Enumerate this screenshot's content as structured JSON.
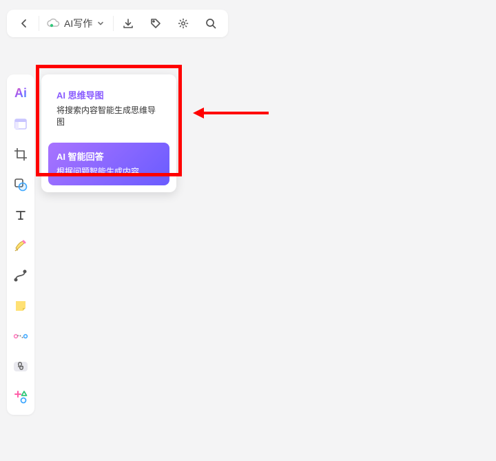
{
  "topbar": {
    "ai_write_label": "AI写作",
    "icons": {
      "back": "back-icon",
      "cloud": "cloud-sync-icon",
      "chevron": "chevron-down-icon",
      "download": "download-icon",
      "tag": "tag-icon",
      "settings": "gear-icon",
      "search": "search-icon"
    }
  },
  "sidebar": {
    "ai_label": "Ai",
    "tools": [
      {
        "name": "ai-tool",
        "icon": "ai-icon"
      },
      {
        "name": "frame-tool",
        "icon": "frame-icon"
      },
      {
        "name": "crop-tool",
        "icon": "crop-icon"
      },
      {
        "name": "shape-tool",
        "icon": "shape-combine-icon"
      },
      {
        "name": "text-tool",
        "icon": "text-icon"
      },
      {
        "name": "pen-tool",
        "icon": "pen-icon"
      },
      {
        "name": "curve-tool",
        "icon": "curve-icon"
      },
      {
        "name": "note-tool",
        "icon": "sticky-note-icon"
      },
      {
        "name": "connector-tool",
        "icon": "connector-icon"
      },
      {
        "name": "link-tool",
        "icon": "link-icon"
      },
      {
        "name": "more-shapes-tool",
        "icon": "more-shapes-icon"
      }
    ]
  },
  "ai_panel": {
    "mindmap": {
      "title": "AI 思维导图",
      "desc": "将搜索内容智能生成思维导图"
    },
    "answer": {
      "title": "AI 智能回答",
      "desc": "根据问题智能生成内容"
    }
  },
  "annotation": {
    "highlight_color": "#ff0000",
    "arrow_color": "#ff0000"
  }
}
